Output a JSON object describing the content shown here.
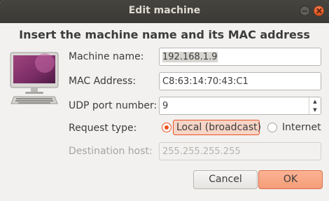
{
  "window": {
    "title": "Edit machine"
  },
  "heading": "Insert the machine name and its MAC address",
  "form": {
    "machine_name": {
      "label": "Machine name:",
      "value": "192.168.1.9"
    },
    "mac_address": {
      "label": "MAC Address:",
      "value": "C8:63:14:70:43:C1"
    },
    "udp_port": {
      "label": "UDP port number:",
      "value": "9"
    },
    "request_type": {
      "label": "Request type:",
      "options": [
        "Local (broadcast)",
        "Internet"
      ],
      "selected": "Local (broadcast)"
    },
    "destination_host": {
      "label": "Destination host:",
      "placeholder": "255.255.255.255"
    }
  },
  "buttons": {
    "cancel": "Cancel",
    "ok": "OK"
  },
  "icons": {
    "computer": "computer-monitor-icon"
  },
  "colors": {
    "accent": "#e95420",
    "titlebar": "#3c3b37"
  }
}
